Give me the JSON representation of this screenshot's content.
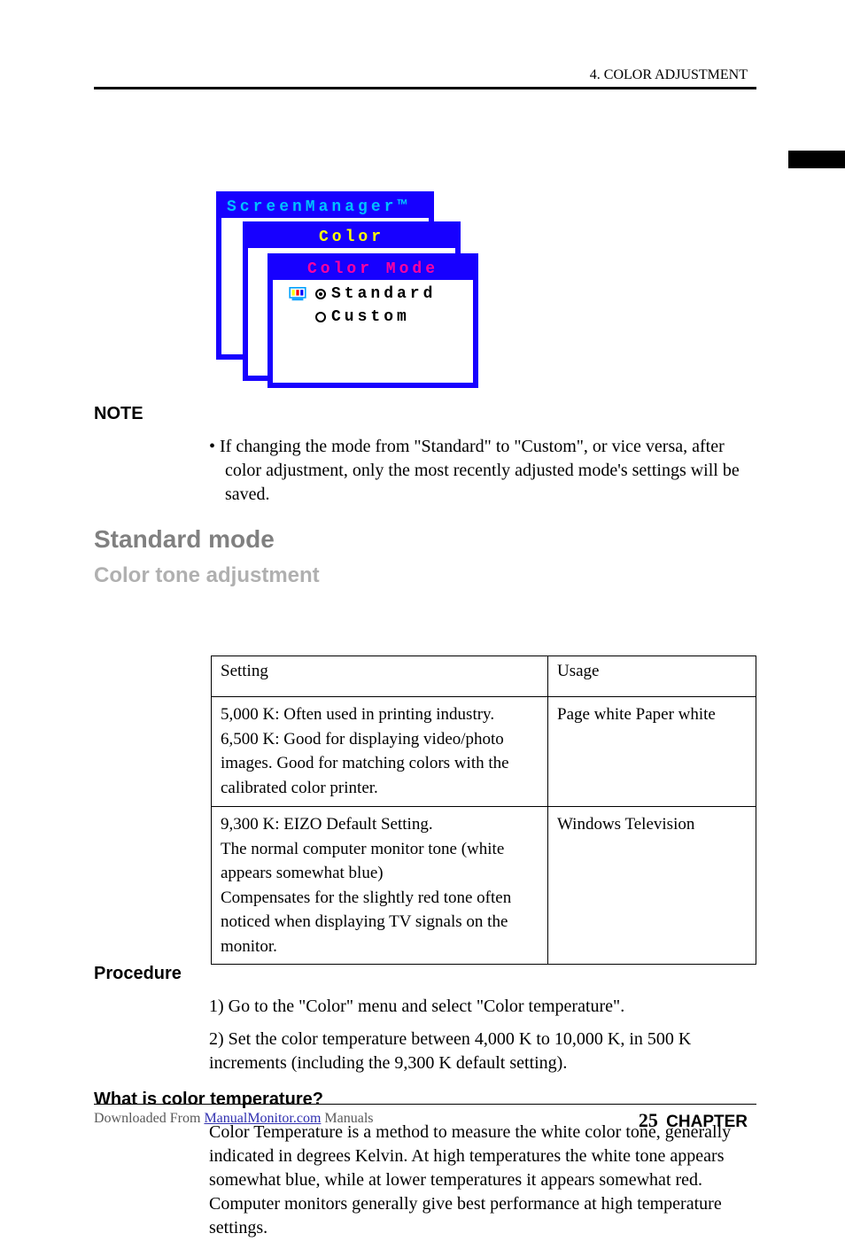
{
  "header": {
    "chapter": "4. COLOR ADJUSTMENT"
  },
  "sidebar": {
    "present": true
  },
  "osd": {
    "win1_title": "ScreenManager™",
    "win2_title": "Color",
    "win3_title": "Color Mode",
    "option_standard": "Standard",
    "option_custom": "Custom"
  },
  "body": {
    "note_label": "NOTE",
    "note_text": "If changing the mode from \"Standard\" to \"Custom\", or vice versa, after color adjustment, only the most recently adjusted mode's settings will be saved.",
    "standard_heading": "Standard mode",
    "color_tone_heading": "Color tone adjustment"
  },
  "procedure": {
    "label1": "Procedure",
    "step1": "1) Go to the \"Color\" menu and select \"Color temperature\".",
    "step2": "2) Set the color temperature between 4,000 K to 10,000 K, in 500 K increments (including the 9,300 K default setting).",
    "label2": "What is color temperature?",
    "desc2": "Color Temperature is a method to measure the white color tone, generally indicated in degrees Kelvin. At high temperatures the white tone appears somewhat blue, while at lower temperatures it appears somewhat red. Computer monitors generally give best performance at high temperature settings."
  },
  "table": {
    "h1": "Setting",
    "h2": "Usage",
    "r1c1": "5,000 K: Often used in printing industry.\n6,500 K: Good for displaying video/photo images. Good for matching colors with the calibrated color printer.",
    "r1c2": "Page white Paper white",
    "r2c1": "9,300 K: EIZO Default Setting.\nThe normal computer monitor tone (white appears somewhat blue)\nCompensates for the slightly red tone often noticed when displaying TV signals on the monitor.",
    "r2c2": "Windows Television"
  },
  "footer": {
    "left": "Downloaded From ",
    "link": "ManualMonitor.com",
    "right": " Manuals",
    "page_num": "25",
    "page_label": "CHAPTER"
  }
}
